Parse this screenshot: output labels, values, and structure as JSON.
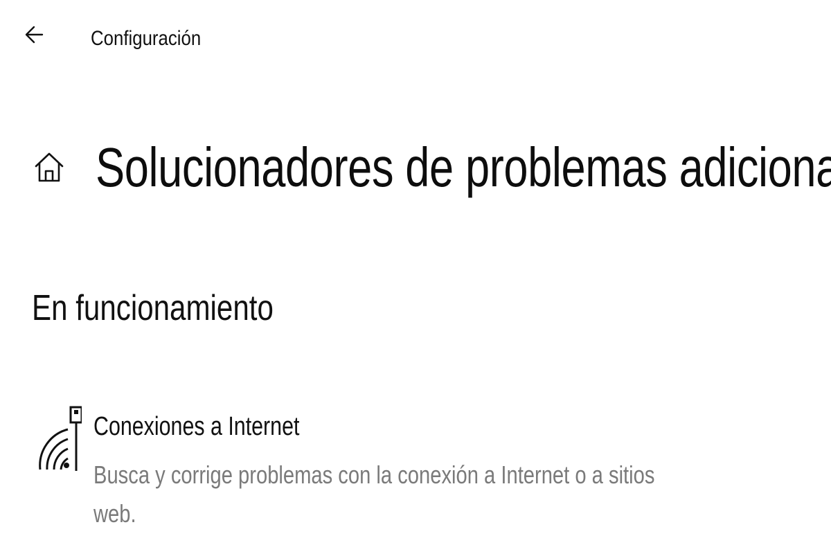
{
  "header": {
    "back_icon": "arrow-left-icon",
    "title": "Configuración"
  },
  "page": {
    "home_icon": "home-icon",
    "title": "Solucionadores de problemas adicionales"
  },
  "section": {
    "title": "En funcionamiento",
    "items": [
      {
        "icon": "internet-connection-icon",
        "title": "Conexiones a Internet",
        "description": "Busca y corrige problemas con la conexión a Internet o a sitios web."
      }
    ]
  },
  "colors": {
    "background": "#ffffff",
    "text_primary": "#111111",
    "text_secondary": "#7a7a7a"
  }
}
